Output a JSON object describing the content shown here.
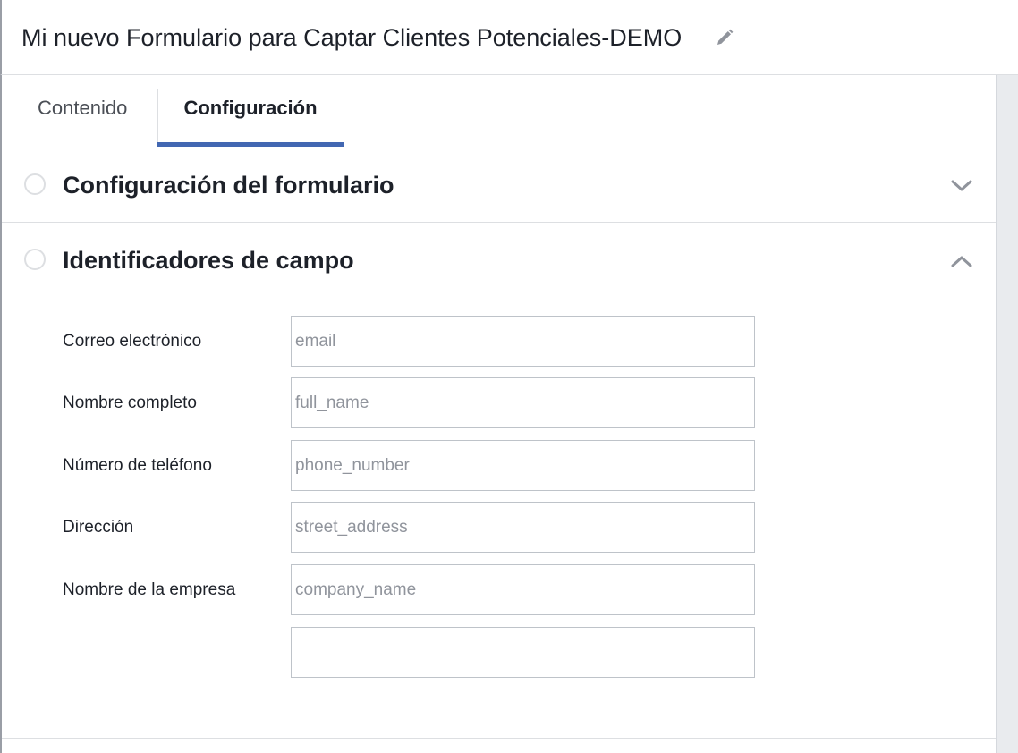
{
  "header": {
    "title": "Mi nuevo Formulario para Captar Clientes Potenciales-DEMO",
    "edit_icon": "pencil-icon"
  },
  "tabs": [
    {
      "label": "Contenido",
      "active": false
    },
    {
      "label": "Configuración",
      "active": true
    }
  ],
  "sections": [
    {
      "title": "Configuración del formulario",
      "expanded": false,
      "chevron_icon": "chevron-down-icon"
    },
    {
      "title": "Identificadores de campo",
      "expanded": true,
      "chevron_icon": "chevron-up-icon"
    }
  ],
  "fields": [
    {
      "label": "Correo electrónico",
      "placeholder": "email",
      "value": ""
    },
    {
      "label": "Nombre completo",
      "placeholder": "full_name",
      "value": ""
    },
    {
      "label": "Número de teléfono",
      "placeholder": "phone_number",
      "value": ""
    },
    {
      "label": "Dirección",
      "placeholder": "street_address",
      "value": ""
    },
    {
      "label": "Nombre de la empresa",
      "placeholder": "company_name",
      "value": ""
    },
    {
      "label": "",
      "placeholder": "",
      "value": ""
    }
  ],
  "colors": {
    "accent": "#4267b2",
    "border": "#dddfe2",
    "input_border": "#bec3c9",
    "placeholder": "#90949c",
    "text": "#1d2129"
  }
}
